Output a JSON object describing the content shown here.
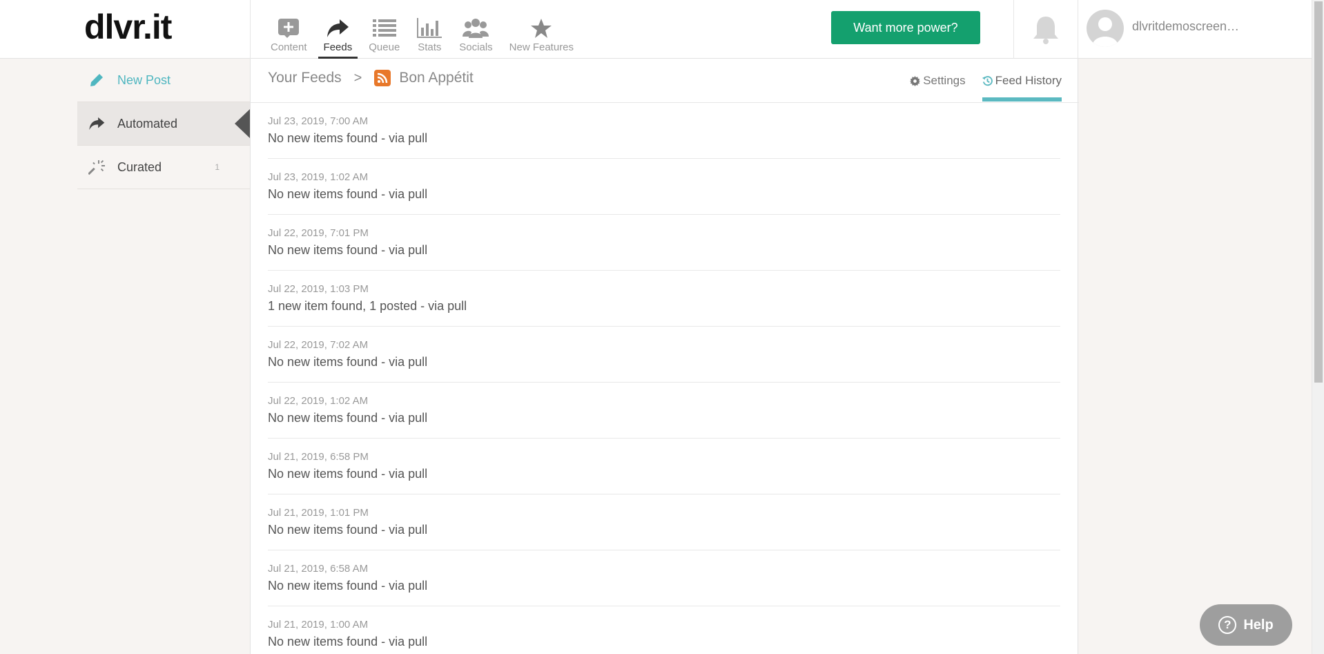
{
  "header": {
    "logo": "dlvr.it",
    "nav": [
      {
        "label": "Content",
        "icon": "plus-box-icon"
      },
      {
        "label": "Feeds",
        "icon": "share-arrow-icon"
      },
      {
        "label": "Queue",
        "icon": "list-icon"
      },
      {
        "label": "Stats",
        "icon": "bar-chart-icon"
      },
      {
        "label": "Socials",
        "icon": "people-icon"
      },
      {
        "label": "New Features",
        "icon": "star-icon"
      }
    ],
    "active_nav": "Feeds",
    "power_button": "Want more power?",
    "username": "dlvritdemoscreen…"
  },
  "sidebar": {
    "items": [
      {
        "label": "New Post",
        "icon": "pencil-icon"
      },
      {
        "label": "Automated",
        "icon": "share-arrow-icon"
      },
      {
        "label": "Curated",
        "icon": "magic-wand-icon",
        "count": "1"
      }
    ]
  },
  "breadcrumb": {
    "root": "Your Feeds",
    "separator": ">",
    "feed": "Bon Appétit"
  },
  "tabs": {
    "settings": "Settings",
    "history": "Feed History"
  },
  "history": [
    {
      "time": "Jul 23, 2019, 7:00 AM",
      "message": "No new items found - via pull"
    },
    {
      "time": "Jul 23, 2019, 1:02 AM",
      "message": "No new items found - via pull"
    },
    {
      "time": "Jul 22, 2019, 7:01 PM",
      "message": "No new items found - via pull"
    },
    {
      "time": "Jul 22, 2019, 1:03 PM",
      "message": "1 new item found, 1 posted - via pull"
    },
    {
      "time": "Jul 22, 2019, 7:02 AM",
      "message": "No new items found - via pull"
    },
    {
      "time": "Jul 22, 2019, 1:02 AM",
      "message": "No new items found - via pull"
    },
    {
      "time": "Jul 21, 2019, 6:58 PM",
      "message": "No new items found - via pull"
    },
    {
      "time": "Jul 21, 2019, 1:01 PM",
      "message": "No new items found - via pull"
    },
    {
      "time": "Jul 21, 2019, 6:58 AM",
      "message": "No new items found - via pull"
    },
    {
      "time": "Jul 21, 2019, 1:00 AM",
      "message": "No new items found - via pull"
    }
  ],
  "help": {
    "label": "Help"
  },
  "colors": {
    "accent": "#14a06e",
    "teal": "#5bb9c1",
    "rss": "#e8782a"
  }
}
